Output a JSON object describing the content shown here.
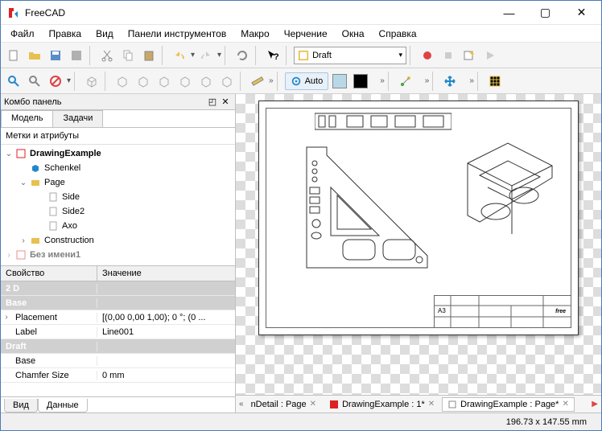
{
  "title": "FreeCAD",
  "menu": [
    "Файл",
    "Правка",
    "Вид",
    "Панели инструментов",
    "Макро",
    "Черчение",
    "Окна",
    "Справка"
  ],
  "draft_label": "Draft",
  "auto_label": "Auto",
  "panel": {
    "title": "Комбо панель",
    "tabs": [
      "Модель",
      "Задачи"
    ],
    "tree_header": "Метки и атрибуты",
    "tree": {
      "root": "DrawingExample",
      "items": [
        "Schenkel",
        "Page",
        "Side",
        "Side2",
        "Axo",
        "Construction",
        "Без имени1"
      ]
    },
    "prop_headers": [
      "Свойство",
      "Значение"
    ],
    "props": {
      "g1": "2 D",
      "g2": "Base",
      "placement_k": "Placement",
      "placement_v": "[(0,00 0,00 1,00); 0 °; (0 ...",
      "label_k": "Label",
      "label_v": "Line001",
      "g3": "Draft",
      "base_k": "Base",
      "chamfer_k": "Chamfer Size",
      "chamfer_v": "0 mm"
    },
    "bottom_tabs": [
      "Вид",
      "Данные"
    ]
  },
  "doc_tabs": {
    "t1": "nDetail : Page",
    "t2": "DrawingExample : 1*",
    "t3": "DrawingExample : Page*"
  },
  "titleblock": {
    "fmt": "A3",
    "logo": "free"
  },
  "status": "196.73 x 147.55 mm"
}
